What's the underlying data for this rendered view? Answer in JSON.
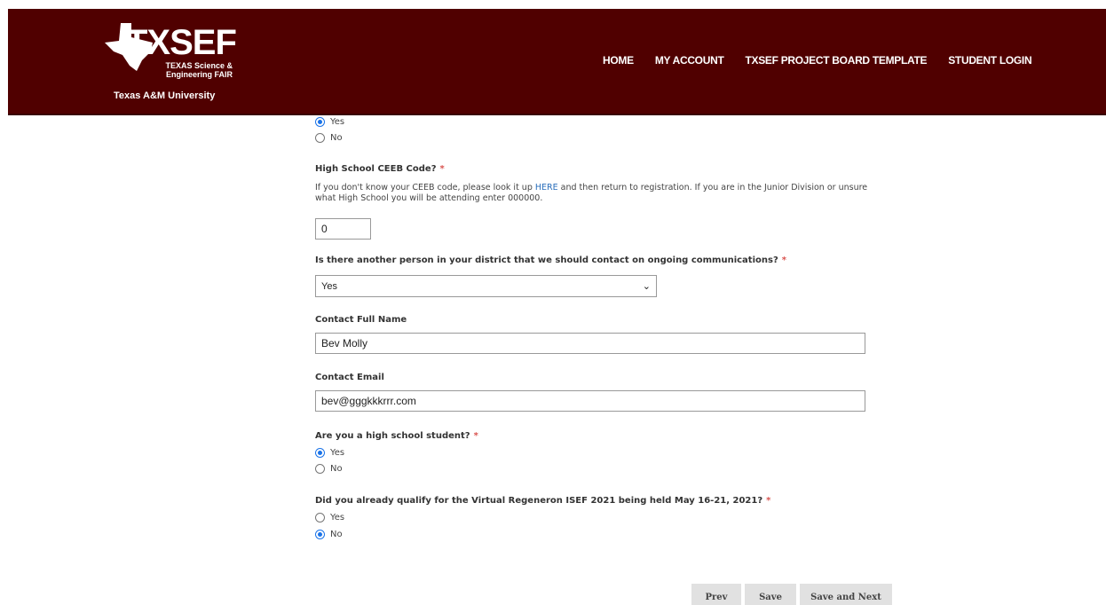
{
  "header": {
    "logo_word": "TXSEF",
    "logo_line1": "TEXAS Science &",
    "logo_line2": "Engineering FAIR",
    "university": "Texas A&M University",
    "nav": [
      "HOME",
      "MY ACCOUNT",
      "TXSEF PROJECT BOARD TEMPLATE",
      "STUDENT LOGIN"
    ]
  },
  "form": {
    "top_radio": {
      "yes": "Yes",
      "no": "No",
      "selected": "Yes"
    },
    "ceeb": {
      "label": "High School CEEB Code?",
      "help_before": "If you don't know your CEEB code, please look it up ",
      "help_link": "HERE",
      "help_after": " and then return to registration. If you are in the Junior Division or unsure what High School you will be attending enter 000000.",
      "value": "0"
    },
    "contact_question": {
      "label": "Is there another person in your district that we should contact on ongoing communications?",
      "selected": "Yes"
    },
    "contact_name": {
      "label": "Contact Full Name",
      "value": "Bev Molly"
    },
    "contact_email": {
      "label": "Contact Email",
      "value": "bev@gggkkkrrr.com"
    },
    "high_school": {
      "label": "Are you a high school student?",
      "yes": "Yes",
      "no": "No",
      "selected": "Yes"
    },
    "isef": {
      "label": "Did you already qualify for the Virtual Regeneron ISEF 2021 being held May 16-21, 2021?",
      "yes": "Yes",
      "no": "No",
      "selected": "No"
    },
    "required_mark": "*"
  },
  "buttons": {
    "prev": "Prev",
    "save": "Save",
    "save_next": "Save and Next"
  },
  "colors": {
    "header_bg": "#500000",
    "required": "#d9534f",
    "radio_selected": "#1a73e8",
    "link": "#2a6ebb"
  }
}
